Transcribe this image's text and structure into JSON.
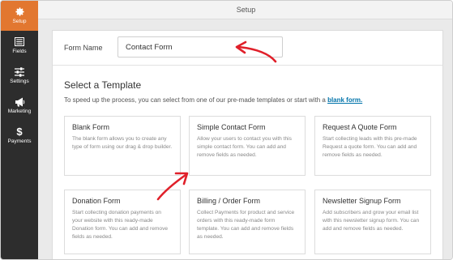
{
  "window": {
    "title": "Setup"
  },
  "sidebar": {
    "items": [
      {
        "label": "Setup",
        "icon": "gear-icon",
        "active": true
      },
      {
        "label": "Fields",
        "icon": "fields-list-icon",
        "active": false
      },
      {
        "label": "Settings",
        "icon": "sliders-icon",
        "active": false
      },
      {
        "label": "Marketing",
        "icon": "megaphone-icon",
        "active": false
      },
      {
        "label": "Payments",
        "icon": "dollar-icon",
        "active": false
      }
    ]
  },
  "form_name": {
    "label": "Form Name",
    "value": "Contact Form"
  },
  "templates": {
    "title": "Select a Template",
    "description": "To speed up the process, you can select from one of our pre-made templates or start with a ",
    "link_text": "blank form.",
    "cards": [
      {
        "title": "Blank Form",
        "desc": "The blank form allows you to create any type of form using our drag & drop builder."
      },
      {
        "title": "Simple Contact Form",
        "desc": "Allow your users to contact you with this simple contact form. You can add and remove fields as needed."
      },
      {
        "title": "Request A Quote Form",
        "desc": "Start collecting leads with this pre-made Request a quote form. You can add and remove fields as needed."
      },
      {
        "title": "Donation Form",
        "desc": "Start collecting donation payments on your website with this ready-made Donation form. You can add and remove fields as needed."
      },
      {
        "title": "Billing / Order Form",
        "desc": "Collect Payments for product and service orders with this ready-made form template. You can add and remove fields as needed."
      },
      {
        "title": "Newsletter Signup Form",
        "desc": "Add subscribers and grow your email list with this newsletter signup form. You can add and remove fields as needed."
      }
    ]
  },
  "colors": {
    "sidebar": "#2d2d2d",
    "accent": "#e27730",
    "link": "#0073aa",
    "arrow": "#e0202a"
  }
}
